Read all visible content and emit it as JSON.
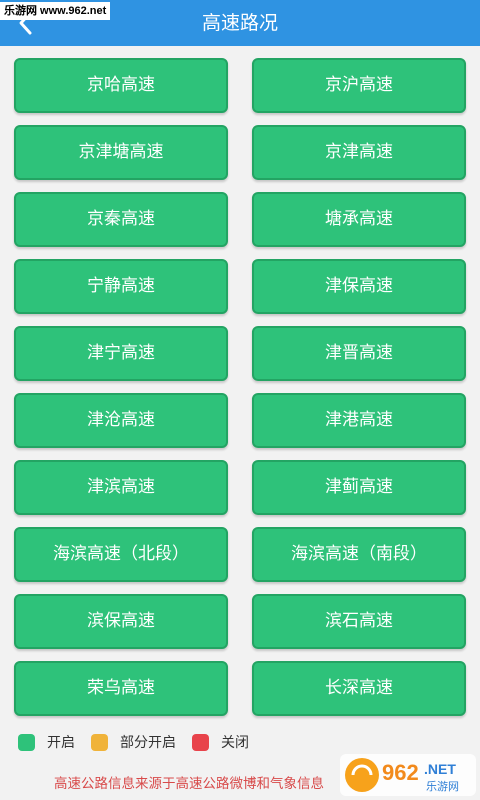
{
  "header": {
    "title": "高速路况",
    "watermark": "乐游网 www.962.net"
  },
  "roads": [
    "京哈高速",
    "京沪高速",
    "京津塘高速",
    "京津高速",
    "京秦高速",
    "塘承高速",
    "宁静高速",
    "津保高速",
    "津宁高速",
    "津晋高速",
    "津沧高速",
    "津港高速",
    "津滨高速",
    "津蓟高速",
    "海滨高速（北段）",
    "海滨高速（南段）",
    "滨保高速",
    "滨石高速",
    "荣乌高速",
    "长深高速"
  ],
  "legend": [
    {
      "label": "开启",
      "color": "#2ec27a"
    },
    {
      "label": "部分开启",
      "color": "#f0b33a"
    },
    {
      "label": "关闭",
      "color": "#e8434b"
    }
  ],
  "footer": {
    "note": "高速公路信息来源于高速公路微博和气象信息"
  },
  "logo": {
    "number": "962",
    "suffix": ".NET",
    "subtitle": "乐游网"
  },
  "colors": {
    "header_bg": "#2f93e2",
    "button_bg": "#2ec27a",
    "page_bg": "#f2f2f2"
  },
  "icons": {
    "back": "back-arrow-icon"
  }
}
